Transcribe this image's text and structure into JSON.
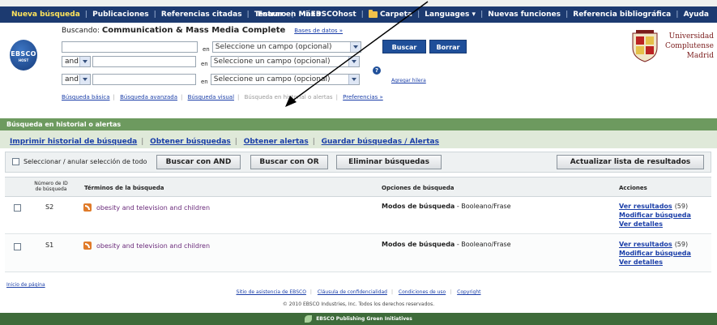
{
  "topnav": {
    "items": [
      "Nueva búsqueda",
      "Publicaciones",
      "Referencias citadas",
      "Tesauro",
      "Más"
    ],
    "right_items": [
      "Entrar en Mi EBSCOhost",
      "Carpeta",
      "Languages",
      "Nuevas funciones",
      "Referencia bibliográfica",
      "Ayuda"
    ]
  },
  "logo": {
    "text": "EBSCO",
    "subtext": "HOST"
  },
  "search": {
    "buscando_label": "Buscando:",
    "database": "Communication & Mass Media Complete",
    "db_link": "Bases de datos »",
    "rows": [
      {
        "bool": "",
        "en": "en",
        "field": "Seleccione un campo (opcional)"
      },
      {
        "bool": "and",
        "en": "en",
        "field": "Seleccione un campo (opcional)"
      },
      {
        "bool": "and",
        "en": "en",
        "field": "Seleccione un campo (opcional)"
      }
    ],
    "buscar": "Buscar",
    "borrar": "Borrar",
    "help": "?",
    "add_row": "Agregar hilera",
    "links": [
      "Búsqueda básica",
      "Búsqueda avanzada",
      "Búsqueda visual",
      "Búsqueda en historial o alertas",
      "Preferencias »"
    ]
  },
  "university": {
    "line1": "Universidad",
    "line2": "Complutense",
    "line3": "Madrid"
  },
  "history": {
    "bar_title": "Búsqueda en historial o alertas",
    "links": [
      "Imprimir historial de búsqueda",
      "Obtener búsquedas",
      "Obtener alertas",
      "Guardar búsquedas / Alertas"
    ]
  },
  "toolbar": {
    "select_all": "Seleccionar / anular selección de todo",
    "buscar_and": "Buscar con AND",
    "buscar_or": "Buscar con OR",
    "eliminar": "Eliminar búsquedas",
    "actualizar": "Actualizar lista de resultados"
  },
  "table": {
    "headers": {
      "id_line1": "Número de ID",
      "id_line2": "de búsqueda",
      "terms": "Términos de la búsqueda",
      "options": "Opciones de búsqueda",
      "actions": "Acciones"
    },
    "rows": [
      {
        "id": "S2",
        "terms": "obesity and television and children",
        "mode_label": "Modos de búsqueda",
        "mode_value": " - Booleano/Frase",
        "ver_resultados": "Ver resultados",
        "count": "(59)",
        "modificar": "Modificar búsqueda",
        "detalles": "Ver detalles"
      },
      {
        "id": "S1",
        "terms": "obesity and television and children",
        "mode_label": "Modos de búsqueda",
        "mode_value": " - Booleano/Frase",
        "ver_resultados": "Ver resultados",
        "count": "(59)",
        "modificar": "Modificar búsqueda",
        "detalles": "Ver detalles"
      }
    ]
  },
  "footer": {
    "inicio": "Inicio de página",
    "links": [
      "Sitio de asistencia de EBSCO",
      "Cláusula de confidencialidad",
      "Condiciones de uso",
      "Copyright"
    ],
    "copyright": "© 2010 EBSCO Industries, Inc. Todos los derechos reservados.",
    "green": "EBSCO Publishing Green Initiatives"
  },
  "colors": {
    "nav": "#1c3a70",
    "green": "#6d9a5f",
    "link": "#1a3ea8"
  }
}
